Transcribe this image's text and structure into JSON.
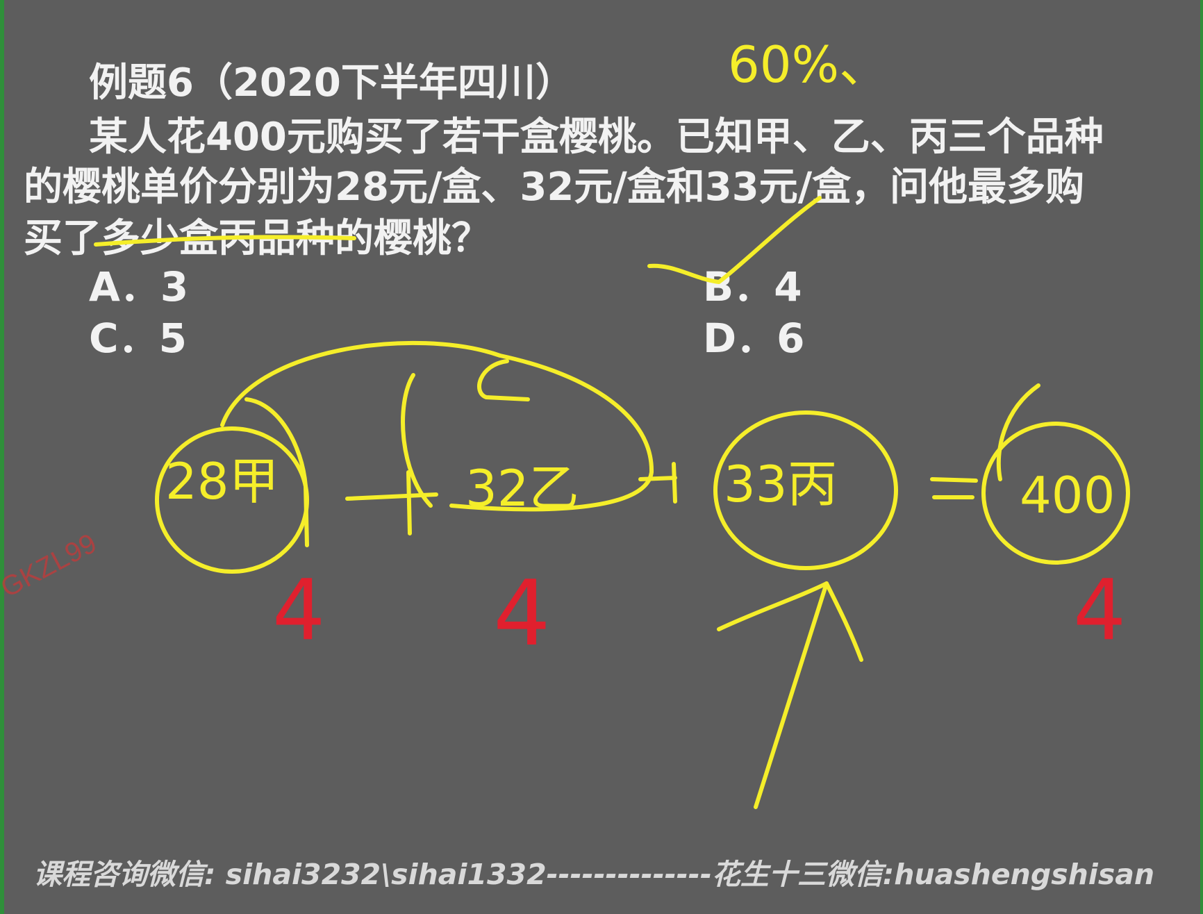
{
  "question": {
    "title": "例题6（2020下半年四川）",
    "line1": "某人花400元购买了若干盒樱桃。已知甲、乙、丙三个品种",
    "line2": "的樱桃单价分别为28元/盒、32元/盒和33元/盒，问他最多购",
    "line3": "买了多少盒丙品种的樱桃？"
  },
  "options": {
    "a": "A．3",
    "b": "B．4",
    "c": "C．5",
    "d": "D．6"
  },
  "annotations": {
    "percent": "60%、",
    "term_a": "28甲",
    "term_b": "32乙",
    "term_c": "33丙",
    "total": "400",
    "red_marks": [
      "4",
      "4",
      "4"
    ]
  },
  "watermark": "GKZL99",
  "footer": "课程咨询微信: sihai3232\\sihai1332--------------花生十三微信:huashengshisan",
  "colors": {
    "background": "#5d5d5d",
    "yellow_ink": "#f5ee2a",
    "red_ink": "#e0202e",
    "text": "#f2f2f2"
  }
}
